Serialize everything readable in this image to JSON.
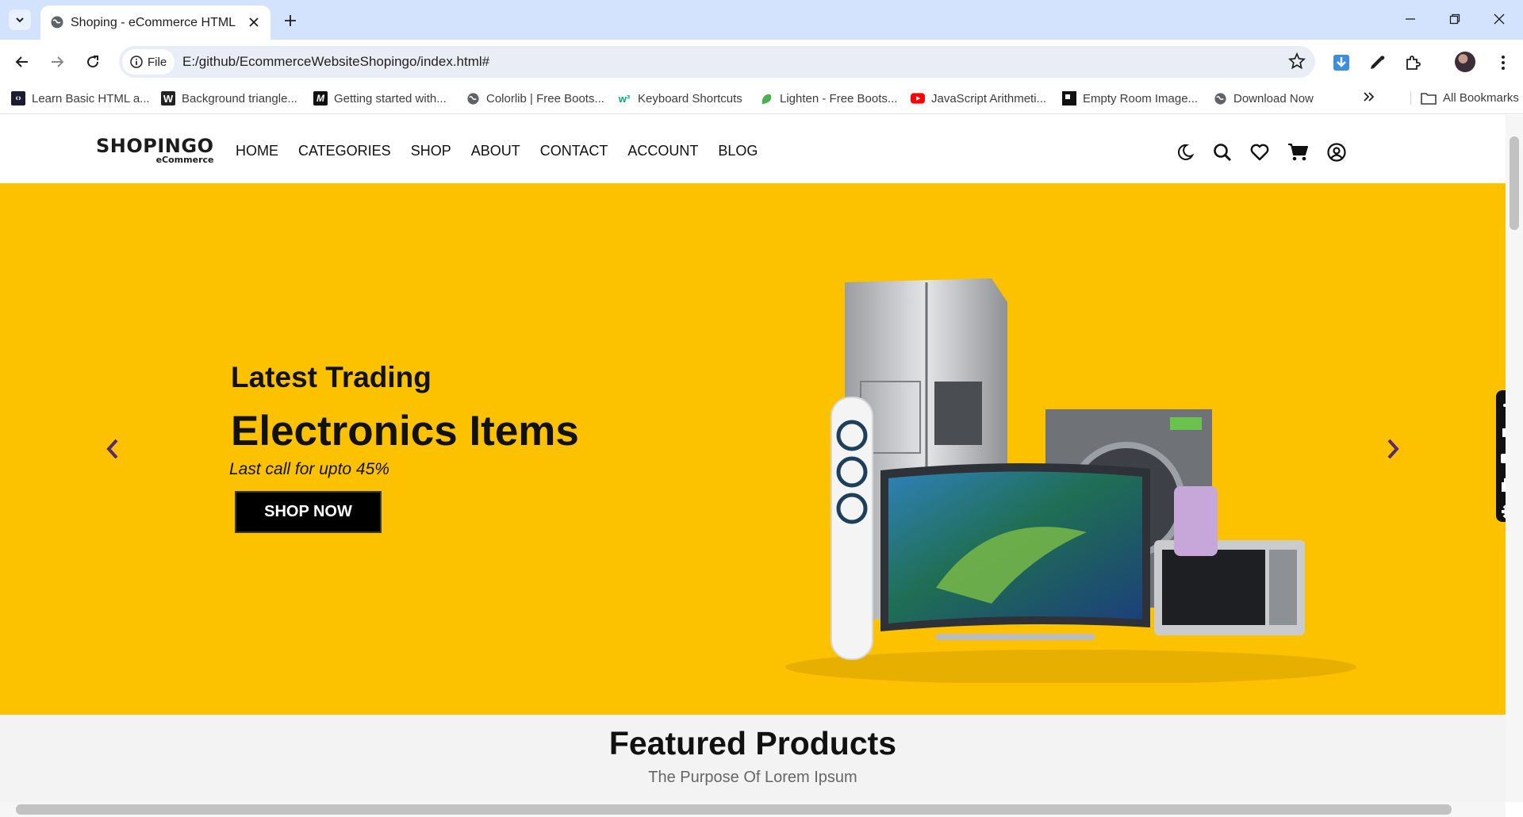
{
  "browser": {
    "tab_title": "Shoping - eCommerce HTML",
    "url_chip": "File",
    "url": "E:/github/EcommerceWebsiteShopingo/index.html#",
    "bookmarks": [
      {
        "label": "Learn Basic HTML a...",
        "icon": "code-icon"
      },
      {
        "label": "Background triangle...",
        "icon": "w-logo-icon"
      },
      {
        "label": "Getting started with...",
        "icon": "m-logo-icon"
      },
      {
        "label": "Colorlib | Free Boots...",
        "icon": "globe-icon"
      },
      {
        "label": "Keyboard Shortcuts",
        "icon": "w3-logo-icon"
      },
      {
        "label": "Lighten - Free Boots...",
        "icon": "leaf-icon"
      },
      {
        "label": "JavaScript Arithmeti...",
        "icon": "youtube-icon"
      },
      {
        "label": "Empty Room Image...",
        "icon": "square-icon"
      },
      {
        "label": "Download Now",
        "icon": "globe-icon"
      }
    ],
    "all_bookmarks": "All Bookmarks"
  },
  "site": {
    "logo_main": "SHOPINGO",
    "logo_sub": "eCommerce",
    "nav": [
      "HOME",
      "CATEGORIES",
      "SHOP",
      "ABOUT",
      "CONTACT",
      "ACCOUNT",
      "BLOG"
    ],
    "header_icons": [
      "moon-icon",
      "search-icon",
      "heart-icon",
      "cart-icon",
      "user-icon"
    ]
  },
  "hero": {
    "subtitle": "Latest Trading",
    "title": "Electronics Items",
    "offer": "Last call for upto 45%",
    "button": "SHOP NOW",
    "accent_color": "#fcc200",
    "arrow_color": "#5b2a6e"
  },
  "featured": {
    "title": "Featured Products",
    "subtitle": "The Purpose Of Lorem Ipsum"
  }
}
